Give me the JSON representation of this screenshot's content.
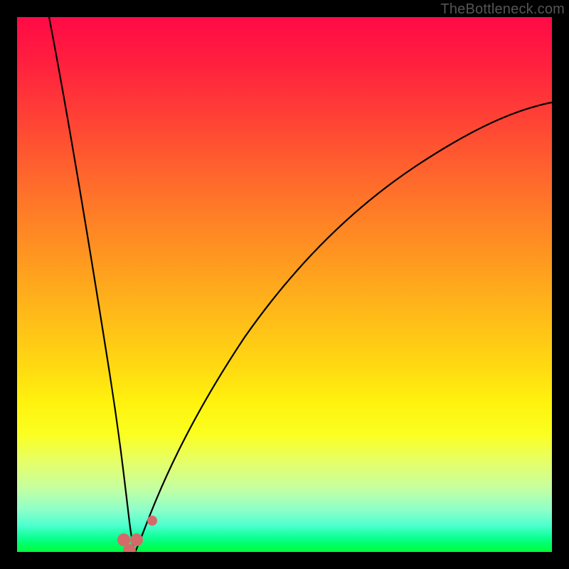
{
  "watermark": "TheBottleneck.com",
  "chart_data": {
    "type": "line",
    "title": "",
    "xlabel": "",
    "ylabel": "",
    "xlim": [
      0,
      100
    ],
    "ylim": [
      0,
      100
    ],
    "grid": false,
    "series": [
      {
        "name": "left-curve",
        "x": [
          6,
          8,
          10,
          12,
          14,
          16,
          18,
          19,
          20,
          21,
          22
        ],
        "values": [
          100,
          86,
          72,
          58,
          44,
          30,
          16,
          9,
          3,
          1,
          0
        ]
      },
      {
        "name": "right-curve",
        "x": [
          22,
          23,
          24,
          26,
          28,
          30,
          34,
          40,
          48,
          58,
          70,
          84,
          100
        ],
        "values": [
          0,
          1,
          3,
          8,
          14,
          21,
          33,
          47,
          59,
          68,
          75,
          80,
          84
        ]
      }
    ],
    "markers": [
      {
        "name": "bottom-left-marker",
        "x": 20.0,
        "y": 2.2
      },
      {
        "name": "bottom-mid-marker",
        "x": 21.0,
        "y": 0.2
      },
      {
        "name": "bottom-right-marker",
        "x": 22.3,
        "y": 2.2
      },
      {
        "name": "upper-right-marker",
        "x": 25.2,
        "y": 5.8
      }
    ],
    "marker_color": "#d46a6a",
    "curve_color": "#000000"
  }
}
